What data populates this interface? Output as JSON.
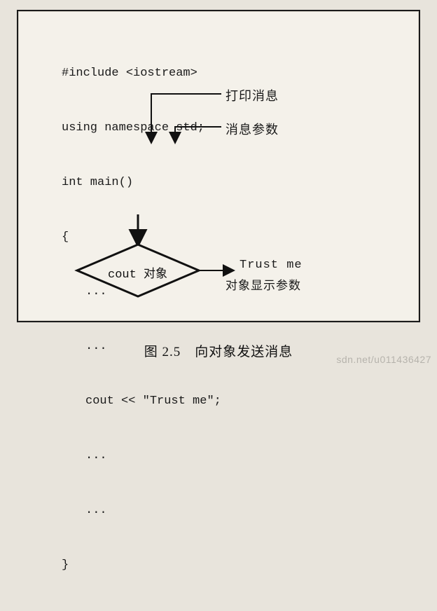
{
  "code": {
    "l1": "#include <iostream>",
    "l2": "using namespace std;",
    "l3": "int main()",
    "l4": "{",
    "l5": "...",
    "l6": "...",
    "l7_a": "cout << ",
    "l7_b": "\"Trust me\"",
    "l7_c": ";",
    "l8": "...",
    "l9": "...",
    "l10": "}"
  },
  "labels": {
    "print_message": "打印消息",
    "message_param": "消息参数",
    "output_text": "Trust me",
    "output_desc": "对象显示参数"
  },
  "diamond": {
    "text_en": "cout ",
    "text_cn": "对象"
  },
  "caption": "图 2.5　向对象发送消息",
  "watermark": "sdn.net/u011436427"
}
